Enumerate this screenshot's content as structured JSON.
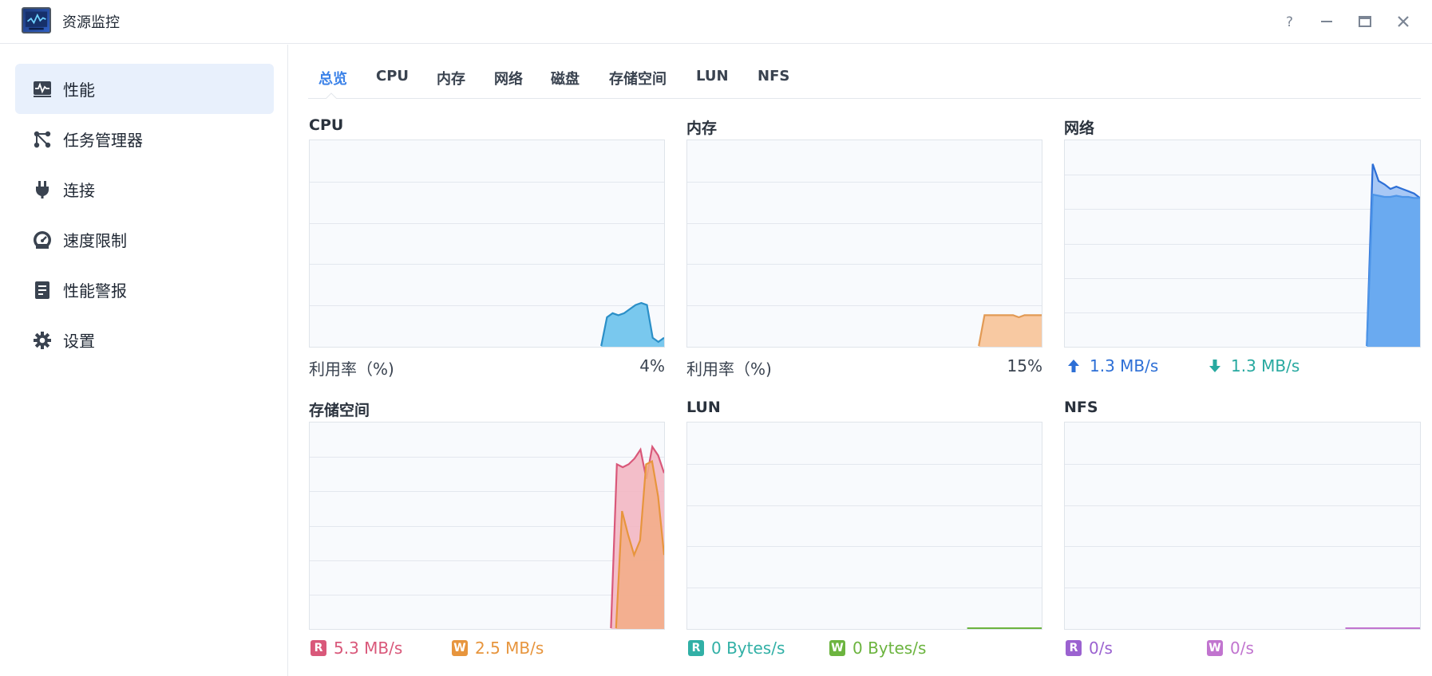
{
  "window": {
    "title": "资源监控",
    "help_icon": "help-icon",
    "minimize_icon": "minimize-icon",
    "maximize_icon": "maximize-icon",
    "close_icon": "close-icon"
  },
  "sidebar": {
    "items": [
      {
        "label": "性能",
        "icon": "performance-icon",
        "active": true
      },
      {
        "label": "任务管理器",
        "icon": "task-manager-icon",
        "active": false
      },
      {
        "label": "连接",
        "icon": "plug-icon",
        "active": false
      },
      {
        "label": "速度限制",
        "icon": "speedometer-icon",
        "active": false
      },
      {
        "label": "性能警报",
        "icon": "alert-document-icon",
        "active": false
      },
      {
        "label": "设置",
        "icon": "gear-icon",
        "active": false
      }
    ]
  },
  "tabs": [
    {
      "label": "总览",
      "active": true
    },
    {
      "label": "CPU"
    },
    {
      "label": "内存"
    },
    {
      "label": "网络"
    },
    {
      "label": "磁盘"
    },
    {
      "label": "存储空间"
    },
    {
      "label": "LUN"
    },
    {
      "label": "NFS"
    }
  ],
  "panels": {
    "cpu": {
      "title": "CPU",
      "metric_label": "利用率（%)",
      "value": "4%"
    },
    "memory": {
      "title": "内存",
      "metric_label": "利用率（%)",
      "value": "15%"
    },
    "network": {
      "title": "网络",
      "upload": "1.3 MB/s",
      "download": "1.3 MB/s"
    },
    "volume": {
      "title": "存储空间",
      "read_badge": "R",
      "read": "5.3 MB/s",
      "write_badge": "W",
      "write": "2.5 MB/s"
    },
    "lun": {
      "title": "LUN",
      "read_badge": "R",
      "read": "0 Bytes/s",
      "write_badge": "W",
      "write": "0 Bytes/s"
    },
    "nfs": {
      "title": "NFS",
      "read_badge": "R",
      "read": "0/s",
      "write_badge": "W",
      "write": "0/s"
    }
  },
  "colors": {
    "accent": "#3b82e8",
    "cpu": "#2b8fc7",
    "cpu_fill": "#79c8ee",
    "memory": "#e29a55",
    "memory_fill": "#f8c9a2",
    "network_up": "#2d6fd6",
    "network_fill": "#6aaaf0",
    "network_down": "#27a9a0",
    "volume_read": "#d9587a",
    "volume_write": "#e7953d",
    "lun_read": "#31b0a6",
    "lun_write": "#6cb43f",
    "nfs_read": "#9b62d0",
    "nfs_write": "#c174cf"
  },
  "chart_data": [
    {
      "type": "area",
      "title": "CPU",
      "ylabel": "利用率（%)",
      "ylim": [
        0,
        100
      ],
      "series": [
        {
          "values": [
            0,
            0,
            0,
            0,
            0,
            0,
            0,
            0,
            0,
            0,
            0,
            0,
            0,
            0,
            0,
            0,
            0,
            0,
            0,
            0,
            0,
            0,
            0,
            0,
            0,
            0,
            0,
            0,
            0,
            0,
            0,
            0,
            0,
            0,
            0,
            0,
            0,
            0,
            0,
            0,
            0,
            0,
            0,
            0,
            0,
            0,
            0,
            0,
            0,
            0,
            0,
            0,
            14,
            16,
            15,
            16,
            18,
            20,
            21,
            20,
            4,
            2,
            4
          ]
        }
      ]
    },
    {
      "type": "area",
      "title": "内存",
      "ylabel": "利用率（%)",
      "ylim": [
        0,
        100
      ],
      "series": [
        {
          "values": [
            0,
            0,
            0,
            0,
            0,
            0,
            0,
            0,
            0,
            0,
            0,
            0,
            0,
            0,
            0,
            0,
            0,
            0,
            0,
            0,
            0,
            0,
            0,
            0,
            0,
            0,
            0,
            0,
            0,
            0,
            0,
            0,
            0,
            0,
            0,
            0,
            0,
            0,
            0,
            0,
            0,
            0,
            0,
            0,
            0,
            0,
            0,
            0,
            0,
            0,
            0,
            0,
            15,
            15,
            15,
            15,
            15,
            15,
            14,
            15,
            15,
            15,
            15
          ]
        }
      ]
    },
    {
      "type": "area",
      "title": "网络",
      "ylim": [
        0,
        1.8
      ],
      "series": [
        {
          "name": "upload",
          "values": [
            0,
            0,
            0,
            0,
            0,
            0,
            0,
            0,
            0,
            0,
            0,
            0,
            0,
            0,
            0,
            0,
            0,
            0,
            0,
            0,
            0,
            0,
            0,
            0,
            0,
            0,
            0,
            0,
            0,
            0,
            0,
            0,
            0,
            0,
            0,
            0,
            0,
            0,
            0,
            0,
            0,
            0,
            0,
            0,
            0,
            0,
            0,
            0,
            0,
            0,
            0,
            0,
            1.6,
            1.45,
            1.42,
            1.38,
            1.4,
            1.38,
            1.36,
            1.34,
            1.3
          ]
        },
        {
          "name": "download",
          "values": [
            0,
            0,
            0,
            0,
            0,
            0,
            0,
            0,
            0,
            0,
            0,
            0,
            0,
            0,
            0,
            0,
            0,
            0,
            0,
            0,
            0,
            0,
            0,
            0,
            0,
            0,
            0,
            0,
            0,
            0,
            0,
            0,
            0,
            0,
            0,
            0,
            0,
            0,
            0,
            0,
            0,
            0,
            0,
            0,
            0,
            0,
            0,
            0,
            0,
            0,
            0,
            0,
            1.33,
            1.32,
            1.31,
            1.31,
            1.32,
            1.31,
            1.31,
            1.3,
            1.3
          ]
        }
      ]
    },
    {
      "type": "area",
      "title": "存储空间",
      "ylim": [
        0,
        7
      ],
      "series": [
        {
          "name": "R",
          "values": [
            0,
            0,
            0,
            0,
            0,
            0,
            0,
            0,
            0,
            0,
            0,
            0,
            0,
            0,
            0,
            0,
            0,
            0,
            0,
            0,
            0,
            0,
            0,
            0,
            0,
            0,
            0,
            0,
            0,
            0,
            0,
            0,
            0,
            0,
            0,
            0,
            0,
            0,
            0,
            0,
            0,
            0,
            0,
            0,
            0,
            0,
            0,
            0,
            0,
            0,
            0,
            0,
            5.6,
            5.5,
            5.6,
            5.8,
            6.1,
            5.1,
            6.2,
            5.9,
            5.3
          ]
        },
        {
          "name": "W",
          "values": [
            0,
            0,
            0,
            0,
            0,
            0,
            0,
            0,
            0,
            0,
            0,
            0,
            0,
            0,
            0,
            0,
            0,
            0,
            0,
            0,
            0,
            0,
            0,
            0,
            0,
            0,
            0,
            0,
            0,
            0,
            0,
            0,
            0,
            0,
            0,
            0,
            0,
            0,
            0,
            0,
            0,
            0,
            0,
            0,
            0,
            0,
            0,
            0,
            0,
            0,
            0,
            0,
            4.0,
            3.2,
            2.5,
            3.0,
            5.6,
            5.7,
            4.5,
            2.5
          ]
        }
      ]
    },
    {
      "type": "area",
      "title": "LUN",
      "ylim": [
        0,
        1
      ],
      "series": [
        {
          "name": "R",
          "values": [
            0,
            0,
            0,
            0,
            0,
            0,
            0,
            0,
            0,
            0
          ]
        },
        {
          "name": "W",
          "values": [
            0,
            0,
            0,
            0,
            0,
            0,
            0,
            0,
            0,
            0
          ]
        }
      ]
    },
    {
      "type": "area",
      "title": "NFS",
      "ylim": [
        0,
        1
      ],
      "series": [
        {
          "name": "R",
          "values": [
            0,
            0,
            0,
            0,
            0,
            0,
            0,
            0,
            0,
            0
          ]
        },
        {
          "name": "W",
          "values": [
            0,
            0,
            0,
            0,
            0,
            0,
            0,
            0,
            0,
            0
          ]
        }
      ]
    }
  ]
}
